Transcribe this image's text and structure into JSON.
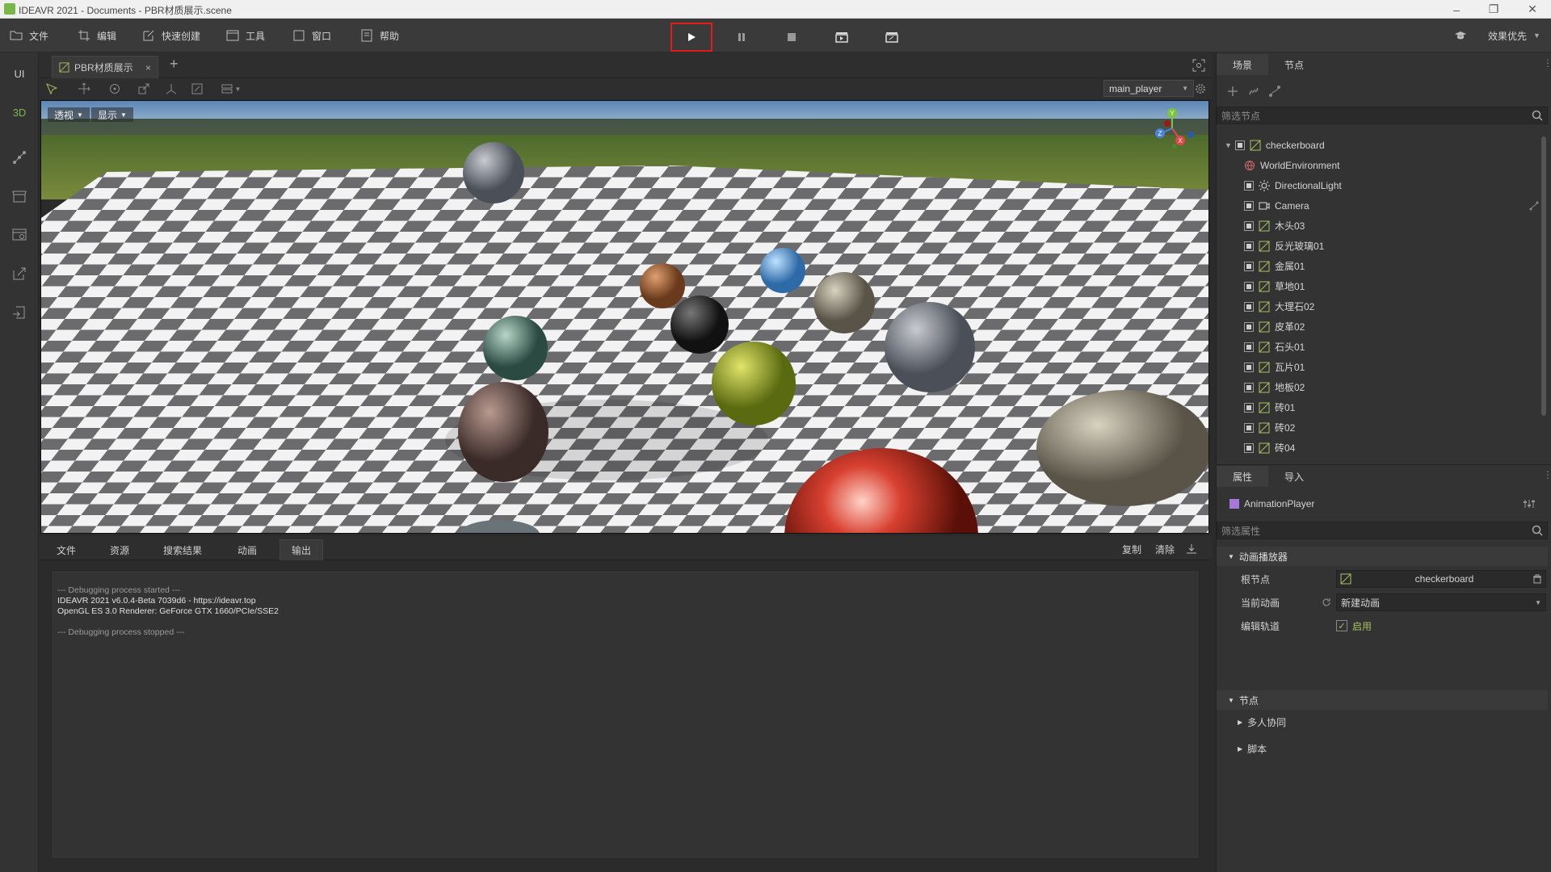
{
  "window": {
    "title": "IDEAVR 2021 - Documents - PBR材质展示.scene"
  },
  "menu": {
    "items": [
      {
        "label": "文件",
        "icon": "folder-icon"
      },
      {
        "label": "编辑",
        "icon": "crop-icon"
      },
      {
        "label": "快速创建",
        "icon": "edit-icon"
      },
      {
        "label": "工具",
        "icon": "window-icon"
      },
      {
        "label": "窗口",
        "icon": "frame-icon"
      },
      {
        "label": "帮助",
        "icon": "help-icon"
      }
    ],
    "quality_label": "效果优先"
  },
  "leftbar": {
    "items": [
      "UI",
      "3D"
    ]
  },
  "doc_tab": {
    "label": "PBR材质展示",
    "close": "×",
    "add": "+"
  },
  "toolbar3d": {
    "player": "main_player"
  },
  "viewport": {
    "perspective_label": "透视",
    "display_label": "显示",
    "gizmo": {
      "x": "X",
      "y": "Y",
      "z": "Z"
    }
  },
  "bottom": {
    "tabs": [
      "文件",
      "资源",
      "搜索结果",
      "动画",
      "输出"
    ],
    "active_tab": 4,
    "copy_label": "复制",
    "clear_label": "清除"
  },
  "console": {
    "lines": [
      "--- Debugging process started ---",
      "IDEAVR 2021 v6.0.4-Beta 7039d6 - https://ideavr.top",
      "OpenGL ES 3.0 Renderer: GeForce GTX 1660/PCIe/SSE2",
      "",
      "--- Debugging process stopped ---"
    ]
  },
  "scene_panel": {
    "tabs": [
      "场景",
      "节点"
    ],
    "filter_placeholder": "筛选节点",
    "root": "checkerboard",
    "nodes": [
      {
        "label": "WorldEnvironment",
        "icon": "globe-icon"
      },
      {
        "label": "DirectionalLight",
        "icon": "sun-icon"
      },
      {
        "label": "Camera",
        "icon": "camera-icon"
      },
      {
        "label": "木头03",
        "icon": "mesh-icon"
      },
      {
        "label": "反光玻璃01",
        "icon": "mesh-icon"
      },
      {
        "label": "金属01",
        "icon": "mesh-icon"
      },
      {
        "label": "草地01",
        "icon": "mesh-icon"
      },
      {
        "label": "大理石02",
        "icon": "mesh-icon"
      },
      {
        "label": "皮革02",
        "icon": "mesh-icon"
      },
      {
        "label": "石头01",
        "icon": "mesh-icon"
      },
      {
        "label": "瓦片01",
        "icon": "mesh-icon"
      },
      {
        "label": "地板02",
        "icon": "mesh-icon"
      },
      {
        "label": "砖01",
        "icon": "mesh-icon"
      },
      {
        "label": "砖02",
        "icon": "mesh-icon"
      },
      {
        "label": "砖04",
        "icon": "mesh-icon"
      }
    ]
  },
  "prop_panel": {
    "tabs": [
      "属性",
      "导入"
    ],
    "node_name": "AnimationPlayer",
    "filter_placeholder": "筛选属性",
    "section_anim": "动画播放器",
    "root_node_label": "根节点",
    "root_node_value": "checkerboard",
    "current_anim_label": "当前动画",
    "current_anim_value": "新建动画",
    "edit_track_label": "编辑轨道",
    "edit_track_value": "启用",
    "section_node": "节点",
    "sub_multi": "多人协同",
    "sub_script": "脚本"
  },
  "colors": {
    "accent_red": "#e01c1c",
    "mesh_green": "#a8c060",
    "bg": "#2b2b2b"
  }
}
